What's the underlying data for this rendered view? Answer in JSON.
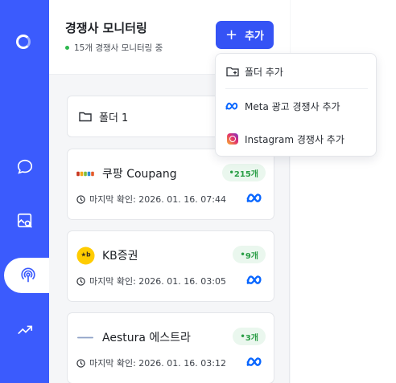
{
  "header": {
    "title": "경쟁사 모니터링",
    "subtitle": "15개 경쟁사 모니터링 중",
    "add_label": "추가",
    "add_icon": "plus-icon"
  },
  "folder": {
    "label": "폴더 1",
    "icon": "folder-icon"
  },
  "competitors": [
    {
      "name": "쿠팡 Coupang",
      "count": "215개",
      "last_checked": "마지막 확인: 2026. 01. 16. 07:44",
      "platform_icon": "meta-icon"
    },
    {
      "name": "KB증권",
      "count": "9개",
      "last_checked": "마지막 확인: 2026. 01. 16. 03:05",
      "platform_icon": "meta-icon"
    },
    {
      "name": "Aestura 에스트라",
      "count": "3개",
      "last_checked": "마지막 확인: 2026. 01. 16. 03:12",
      "platform_icon": "meta-icon"
    }
  ],
  "dropdown": {
    "items": [
      {
        "label": "폴더 추가",
        "icon": "folder-add-icon"
      },
      {
        "label": "Meta 광고 경쟁사 추가",
        "icon": "meta-icon"
      },
      {
        "label": "Instagram 경쟁사 추가",
        "icon": "instagram-icon"
      }
    ]
  },
  "rail": {
    "items": [
      "logo",
      "chat-icon",
      "image-search-icon",
      "broadcast-icon",
      "trending-up-icon"
    ],
    "active": "broadcast-icon"
  },
  "colors": {
    "accent": "#3553f5",
    "rail": "#3b5bfd",
    "badge_text": "#2a9e46",
    "badge_bg": "#eaf7ee",
    "meta_blue": "#0866ff"
  }
}
